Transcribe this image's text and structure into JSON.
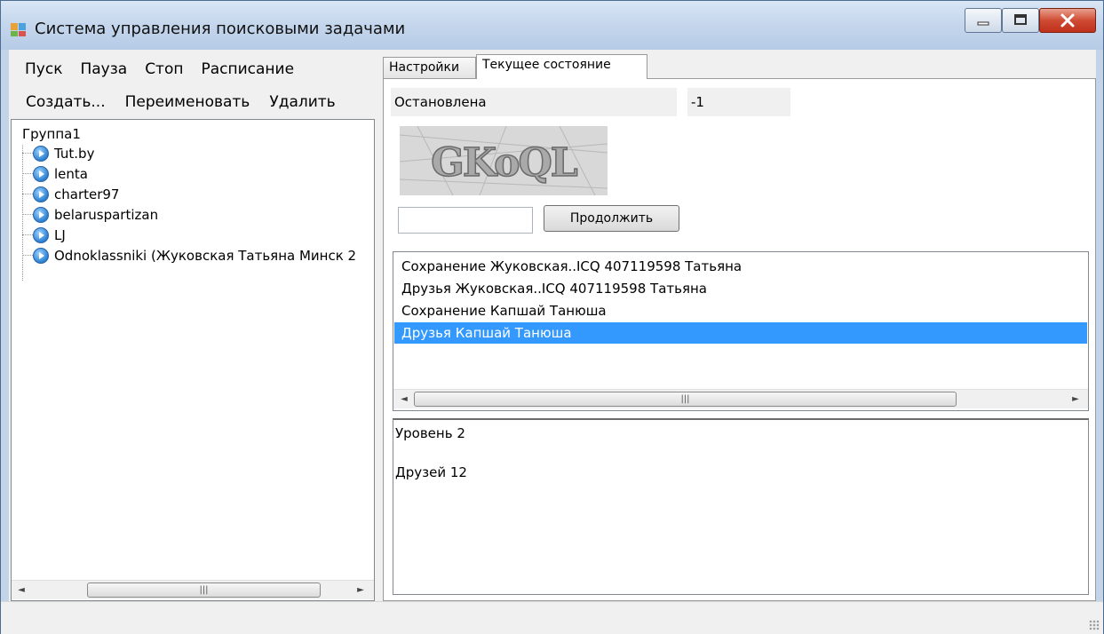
{
  "window": {
    "title": "Система управления поисковыми задачами",
    "controls": [
      "minimize-icon",
      "maximize-icon",
      "close-icon"
    ]
  },
  "menu": {
    "row1": [
      "Пуск",
      "Пауза",
      "Стоп",
      "Расписание"
    ],
    "row2": [
      "Создать...",
      "Переименовать",
      "Удалить"
    ]
  },
  "tree": {
    "root": "Группа1",
    "items": [
      "Tut.by",
      "lenta",
      "charter97",
      "belaruspartizan",
      "LJ",
      "Odnoklassniki (Жуковская Татьяна Минск 2"
    ],
    "item_icon": "play-circle-icon",
    "scroll_grip": "|||"
  },
  "tabs": [
    {
      "label": "Настройки",
      "active": false
    },
    {
      "label": "Текущее состояние",
      "active": true
    }
  ],
  "state": {
    "status": "Остановлена",
    "code": "-1",
    "captcha_text": "GKoQL",
    "captcha_input": "",
    "continue_label": "Продолжить"
  },
  "log": {
    "items": [
      "Сохранение Жуковская..ICQ 407119598 Татьяна",
      "Друзья Жуковская..ICQ 407119598 Татьяна",
      "Сохранение Капшай Танюша",
      "Друзья Капшай Танюша"
    ],
    "selected_index": 3,
    "scroll_grip": "|||"
  },
  "details": {
    "level": "Уровень 2",
    "friends": "Друзей 12"
  },
  "colors": {
    "selection": "#3399ff",
    "title_bar": "#c4d6ec",
    "close_button": "#cf4b33"
  }
}
